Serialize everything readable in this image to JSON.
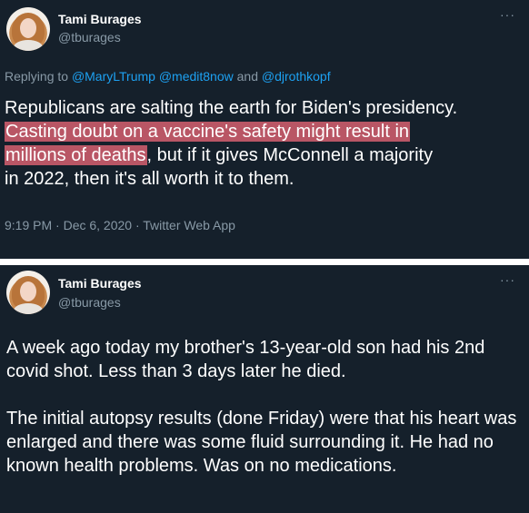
{
  "tweet1": {
    "author_name": "Tami Burages",
    "author_handle": "@tburages",
    "more_label": "···",
    "replying_prefix": "Replying to",
    "replying_to": [
      "@MaryLTrump",
      "@medit8now",
      "@djrothkopf"
    ],
    "replying_and": "and",
    "body_lines": [
      "Republicans are salting the earth for Biden's presidency.",
      "Casting doubt on a vaccine's safety might result in",
      "millions of deaths",
      ", but if it gives McConnell a majority",
      "in 2022, then it's all worth it to them."
    ],
    "highlight_color": "#e86576",
    "timestamp": "9:19 PM · Dec 6, 2020 · Twitter Web App"
  },
  "tweet2": {
    "author_name": "Tami Burages",
    "author_handle": "@tburages",
    "more_label": "···",
    "paragraph1": "A week ago today my brother's 13-year-old son had his 2nd covid shot.  Less than 3 days later he died.",
    "paragraph2": "The initial autopsy results (done Friday) were that his heart was enlarged and there was some fluid surrounding it. He had no known health problems. Was on no medications."
  },
  "colors": {
    "background": "#15202b",
    "text": "#ffffff",
    "secondary_text": "#8899a6",
    "link": "#1da1f2",
    "divider": "#ffffff"
  },
  "icons": {
    "avatar": "profile-photo",
    "more": "more-options-icon"
  }
}
